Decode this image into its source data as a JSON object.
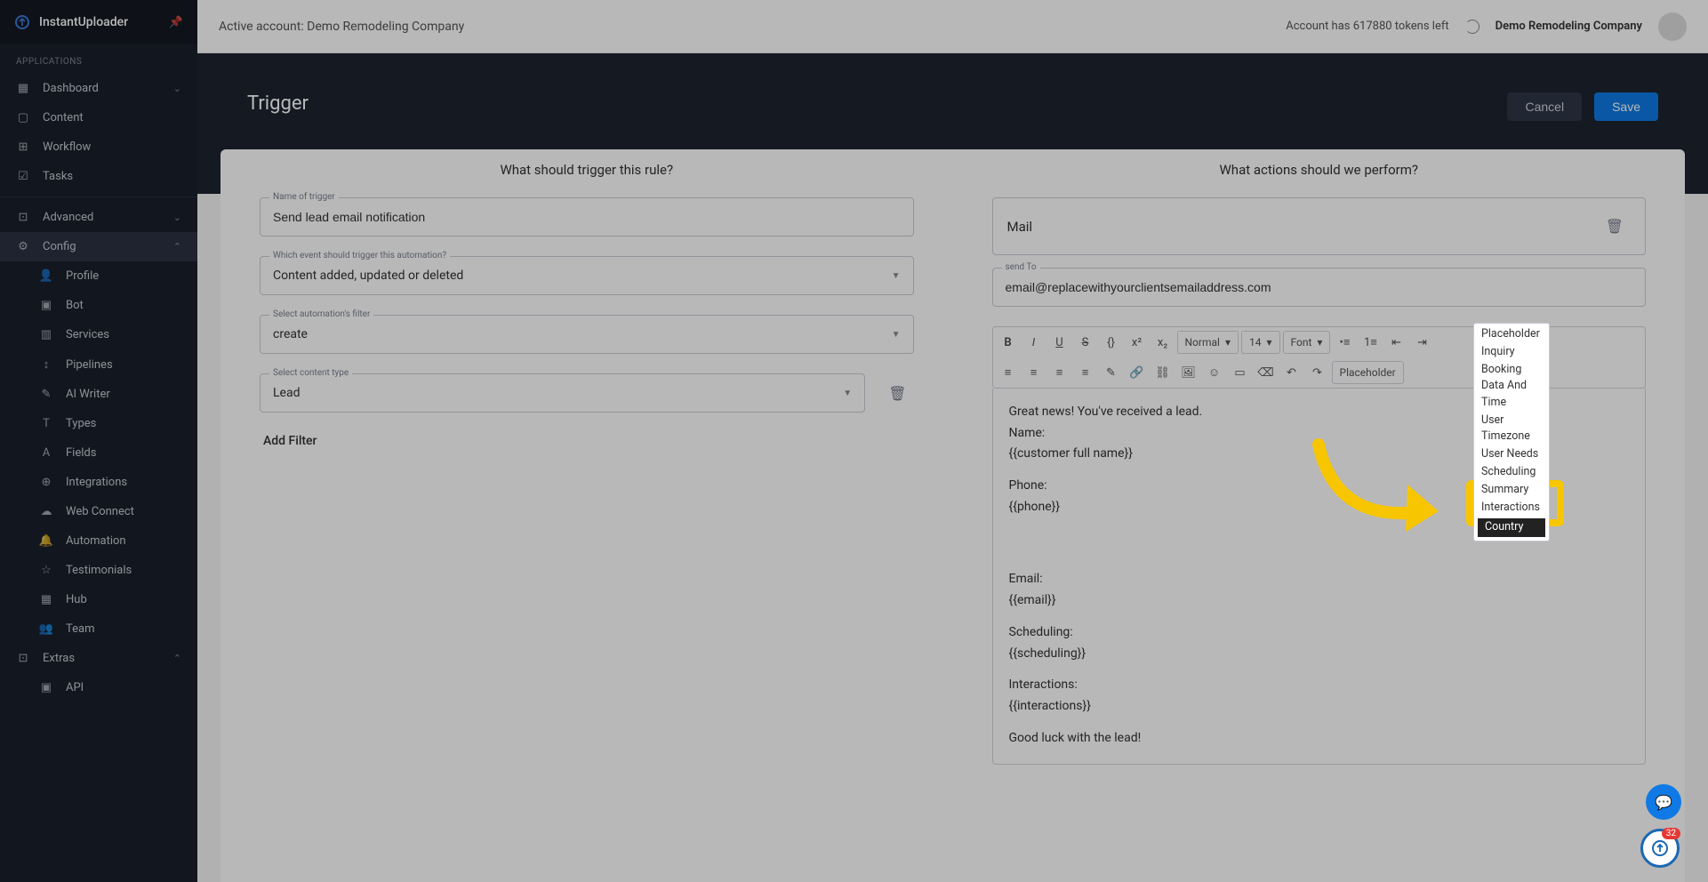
{
  "brand": "InstantUploader",
  "sidebar": {
    "section": "APPLICATIONS",
    "dashboard": "Dashboard",
    "content": "Content",
    "workflow": "Workflow",
    "tasks": "Tasks",
    "advanced": "Advanced",
    "config": "Config",
    "profile": "Profile",
    "bot": "Bot",
    "services": "Services",
    "pipelines": "Pipelines",
    "ai_writer": "AI Writer",
    "types": "Types",
    "fields": "Fields",
    "integrations": "Integrations",
    "web_connect": "Web Connect",
    "automation": "Automation",
    "testimonials": "Testimonials",
    "hub": "Hub",
    "team": "Team",
    "extras": "Extras",
    "api": "API"
  },
  "topbar": {
    "active_account_label": "Active account: Demo Remodeling Company",
    "tokens_text": "Account has 617880 tokens left",
    "user_name": "Demo Remodeling Company"
  },
  "panel": {
    "title": "Trigger",
    "cancel": "Cancel",
    "save": "Save"
  },
  "left": {
    "heading": "What should trigger this rule?",
    "name_label": "Name of trigger",
    "name_value": "Send lead email notification",
    "event_label": "Which event should trigger this automation?",
    "event_value": "Content added, updated or deleted",
    "filter_label": "Select automation's filter",
    "filter_value": "create",
    "type_label": "Select content type",
    "type_value": "Lead",
    "add_filter": "Add Filter"
  },
  "right": {
    "heading": "What actions should we perform?",
    "mail_label": "Mail",
    "send_to_label": "send To",
    "send_to_value": "email@replacewithyourclientsemailaddress.com",
    "format_normal": "Normal",
    "format_size": "14",
    "format_font": "Font",
    "body_intro": "Great news! You've received a lead.",
    "body_name_l": "Name:",
    "body_name_v": "{{customer full name}}",
    "body_phone_l": "Phone:",
    "body_phone_v": "{{phone}}",
    "body_email_l": "Email:",
    "body_email_v": "{{email}}",
    "body_sched_l": "Scheduling:",
    "body_sched_v": "{{scheduling}}",
    "body_inter_l": "Interactions:",
    "body_inter_v": "{{interactions}}",
    "body_outro": "Good luck with the lead!"
  },
  "placeholder_menu": {
    "title": "Placeholder",
    "items": [
      "Inquiry",
      "Booking Data And Time",
      "User Timezone",
      "User Needs",
      "Scheduling",
      "Summary",
      "Interactions",
      "Country"
    ]
  },
  "fab_badge": "32"
}
